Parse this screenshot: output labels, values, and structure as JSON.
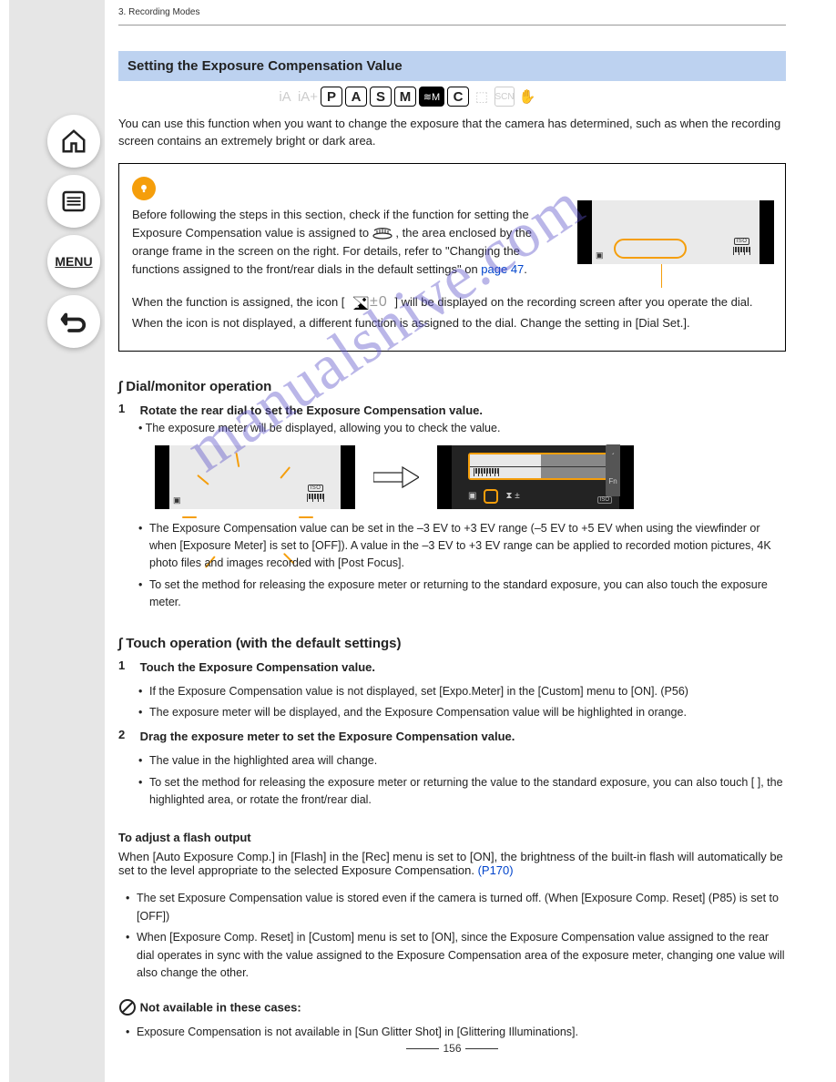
{
  "header_breadcrumb": "3. Recording Modes",
  "nav": {
    "home": "home-icon",
    "list": "list-icon",
    "menu": "MENU",
    "back": "back-icon"
  },
  "title": "Setting the Exposure Compensation Value",
  "modes": {
    "ghost_ia": "iA",
    "ghost_ia_plus": "iA+",
    "p": "P",
    "a": "A",
    "s": "S",
    "m": "M",
    "movie": "≋M",
    "c": "C",
    "ghost_pano": "⬚",
    "ghost_scn": "SCN",
    "ghost_creative": "✋"
  },
  "intro": "You can use this function when you want to change the exposure that the camera has determined, such as when the recording screen contains an extremely bright or dark area.",
  "tip": {
    "line1_a": "Before following the steps in this section, check if the function for setting the Exposure Compensation value is assigned to ",
    "line1_b": ", the area enclosed by the orange frame in the screen on the right. For details, refer to \"Changing the functions assigned to the front/rear dials in the default settings\" on ",
    "line1_link": "page 47",
    "line1_c": ".",
    "line2_a": "When the function is assigned, the icon [",
    "line2_b": "] will be displayed on the recording screen after you operate the dial. When the icon is not displayed, a different function is assigned to the dial. Change the setting in [Dial Set.]."
  },
  "ev_icon": {
    "symbol": "⧗",
    "value": "±0"
  },
  "camera_panel": {
    "iso": "ISO"
  },
  "dial_monitor": {
    "heading": "∫ Dial/monitor operation",
    "step1_num": "1",
    "step1_txt": "Rotate the rear dial to set the Exposure Compensation value.",
    "step1_sub": "The exposure meter will be displayed, allowing you to check the value."
  },
  "panel_b": {
    "fn": "Fn",
    "caret": "‹",
    "iso": "ISO",
    "ev": "⧗ ±"
  },
  "arrow_label": "arrow-right",
  "notes": [
    "The Exposure Compensation value can be set in the –3 EV to +3 EV range (–5 EV to +5 EV when using the viewfinder or when [Exposure Meter] is set to [OFF]). A value in the –3 EV to +3 EV range can be applied to recorded motion pictures, 4K photo files and images recorded with [Post Focus].",
    "To set the method for releasing the exposure meter or returning to the standard exposure, you can also touch the exposure meter."
  ],
  "touch": {
    "heading": "∫ Touch operation (with the default settings)",
    "step1_num": "1",
    "step1_txt": "Touch the Exposure Compensation value.",
    "bullets": [
      "If the Exposure Compensation value is not displayed, set [Expo.Meter] in the [Custom] menu to [ON]. (P56)",
      "The exposure meter will be displayed, and the Exposure Compensation value will be highlighted in orange."
    ],
    "step2_num": "2",
    "step2_txt": "Drag the exposure meter to set the Exposure Compensation value.",
    "bullets2": [
      "The value in the highlighted area will change.",
      "To set the method for releasing the exposure meter or returning the value to the standard exposure, you can also touch [ ], the highlighted area, or rotate the front/rear dial."
    ]
  },
  "subhead": "To adjust a flash output",
  "subtext_a": "When [Auto Exposure Comp.] in [Flash] in the [Rec] menu is set to [ON], the brightness of the built-in flash will automatically be set to the level appropriate to the selected Exposure Compensation. ",
  "subtext_link": "(P170)",
  "footer_bullets": [
    "The set Exposure Compensation value is stored even if the camera is turned off. (When [Exposure Comp. Reset] (P85) is set to [OFF])",
    "When [Exposure Comp. Reset] in [Custom] menu is set to [ON], since the Exposure Compensation value assigned to the rear dial operates in sync with the value assigned to the Exposure Compensation area of the exposure meter, changing one value will also change the other."
  ],
  "notavail_head": "Not available in these cases:",
  "notavail_item": "Exposure Compensation is not available in [Sun Glitter Shot] in [Glittering Illuminations].",
  "page_number": "156",
  "watermark": "manualshive.com"
}
